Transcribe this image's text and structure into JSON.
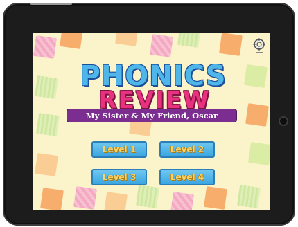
{
  "app": {
    "title_line1": "PHONICS",
    "title_line2": "REVIEW",
    "subtitle": "My Sister & My Friend, Oscar"
  },
  "levels": [
    {
      "label": "Level 1"
    },
    {
      "label": "Level 2"
    },
    {
      "label": "Level 3"
    },
    {
      "label": "Level 4"
    }
  ],
  "icons": {
    "settings": "gear-icon"
  },
  "colors": {
    "background": "#fbf3c9",
    "title_blue": "#4fb6ea",
    "title_pink": "#e8327f",
    "banner_purple": "#7b2e8f",
    "button_blue": "#3aa6e0",
    "button_text": "#f3d36a"
  }
}
